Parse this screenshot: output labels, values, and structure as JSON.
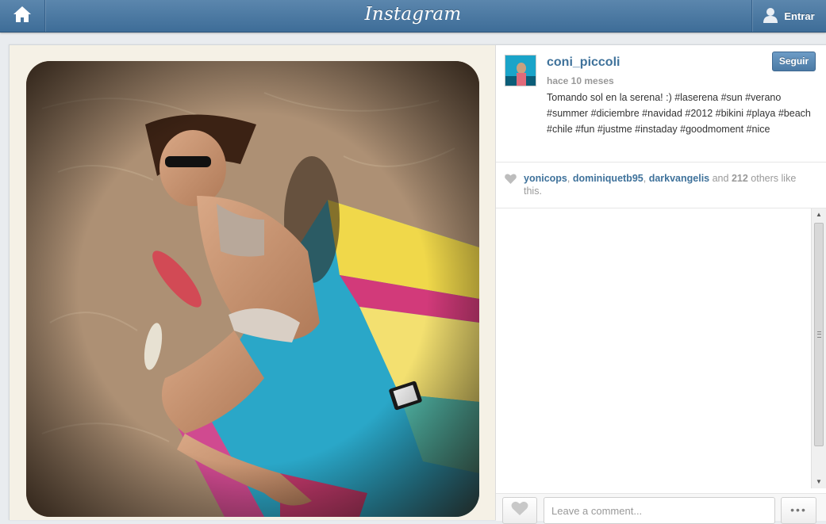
{
  "header": {
    "logo": "Instagram",
    "home_icon": "home-icon",
    "login_label": "Entrar",
    "login_icon": "user-icon"
  },
  "post": {
    "username": "coni_piccoli",
    "timestamp": "hace 10 meses",
    "follow_label": "Seguir",
    "caption": "Tomando sol en la serena! :) #laserena #sun #verano #summer #diciembre #navidad #2012 #bikini #playa #beach #chile #fun #justme #instaday #goodmoment #nice",
    "likes": {
      "users": [
        "yonicops",
        "dominiquetb95",
        "darkvangelis"
      ],
      "and_text": "and",
      "count": "212",
      "suffix": "others like this."
    }
  },
  "comment_box": {
    "placeholder": "Leave a comment...",
    "more_label": "•••"
  },
  "colors": {
    "topbar": "#4a78a3",
    "link": "#3f729b",
    "follow_button": "#5a8ab6"
  }
}
